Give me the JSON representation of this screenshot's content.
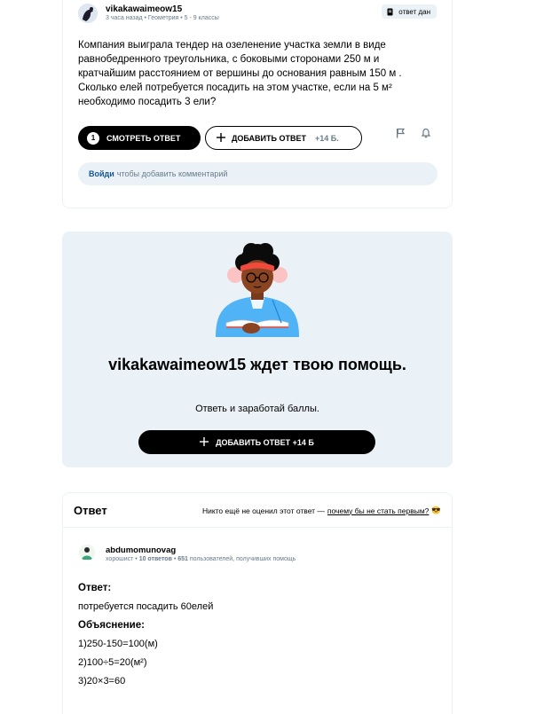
{
  "question": {
    "author": "vikakawaimeow15",
    "meta": "3 часа назад • Геометрия • 5 - 9 классы",
    "status_badge": "ответ дан",
    "text": "Компания выиграла тендер на озеленение участка земли в виде равнобедренного треугольника, с боковыми сторонами 250 м и кратчайшим расстоянием от вершины до основания равным 150 м . Сколько елей потребуется посадить на этом участке, если на 5 м² необходимо посадить 3 ели?",
    "answers_count": "1",
    "view_answer_label": "СМОТРЕТЬ ОТВЕТ",
    "add_answer_label": "ДОБАВИТЬ ОТВЕТ",
    "add_answer_points": "+14 Б.",
    "comment_login": "Войди",
    "comment_hint": "чтобы добавить комментарий"
  },
  "help": {
    "title": "vikakawaimeow15 ждет твою помощь.",
    "subtitle": "Ответь и заработай баллы.",
    "add_answer_label": "ДОБАВИТЬ ОТВЕТ +14 Б"
  },
  "answer": {
    "section_title": "Ответ",
    "rate_prefix": "Никто ещё не оценил этот ответ —",
    "rate_link": "почему бы не стать первым?",
    "rate_emoji": "😎",
    "author": "abdumomunovag",
    "rank": "хорошист",
    "answers_count": "10 ответов",
    "helped_count": "651",
    "helped_text": "пользователей, получивших помощь",
    "lines": [
      {
        "text": "Ответ:",
        "bold": true
      },
      {
        "text": "потребуется посадить 60елей",
        "bold": false
      },
      {
        "text": "Объяснение:",
        "bold": true
      },
      {
        "text": "1)250-150=100(м)",
        "bold": false
      },
      {
        "text": "2)100÷5=20(м²)",
        "bold": false
      },
      {
        "text": "3)20×3=60",
        "bold": false
      }
    ]
  },
  "icons": {
    "badge": "answer-doc-icon",
    "flag": "flag-icon",
    "bell": "bell-icon",
    "plus": "plus-icon"
  },
  "colors": {
    "surface_grey": "#ebf2f7",
    "text_secondary": "#687b8c",
    "link_blue": "#135495",
    "primary_black": "#000000"
  }
}
